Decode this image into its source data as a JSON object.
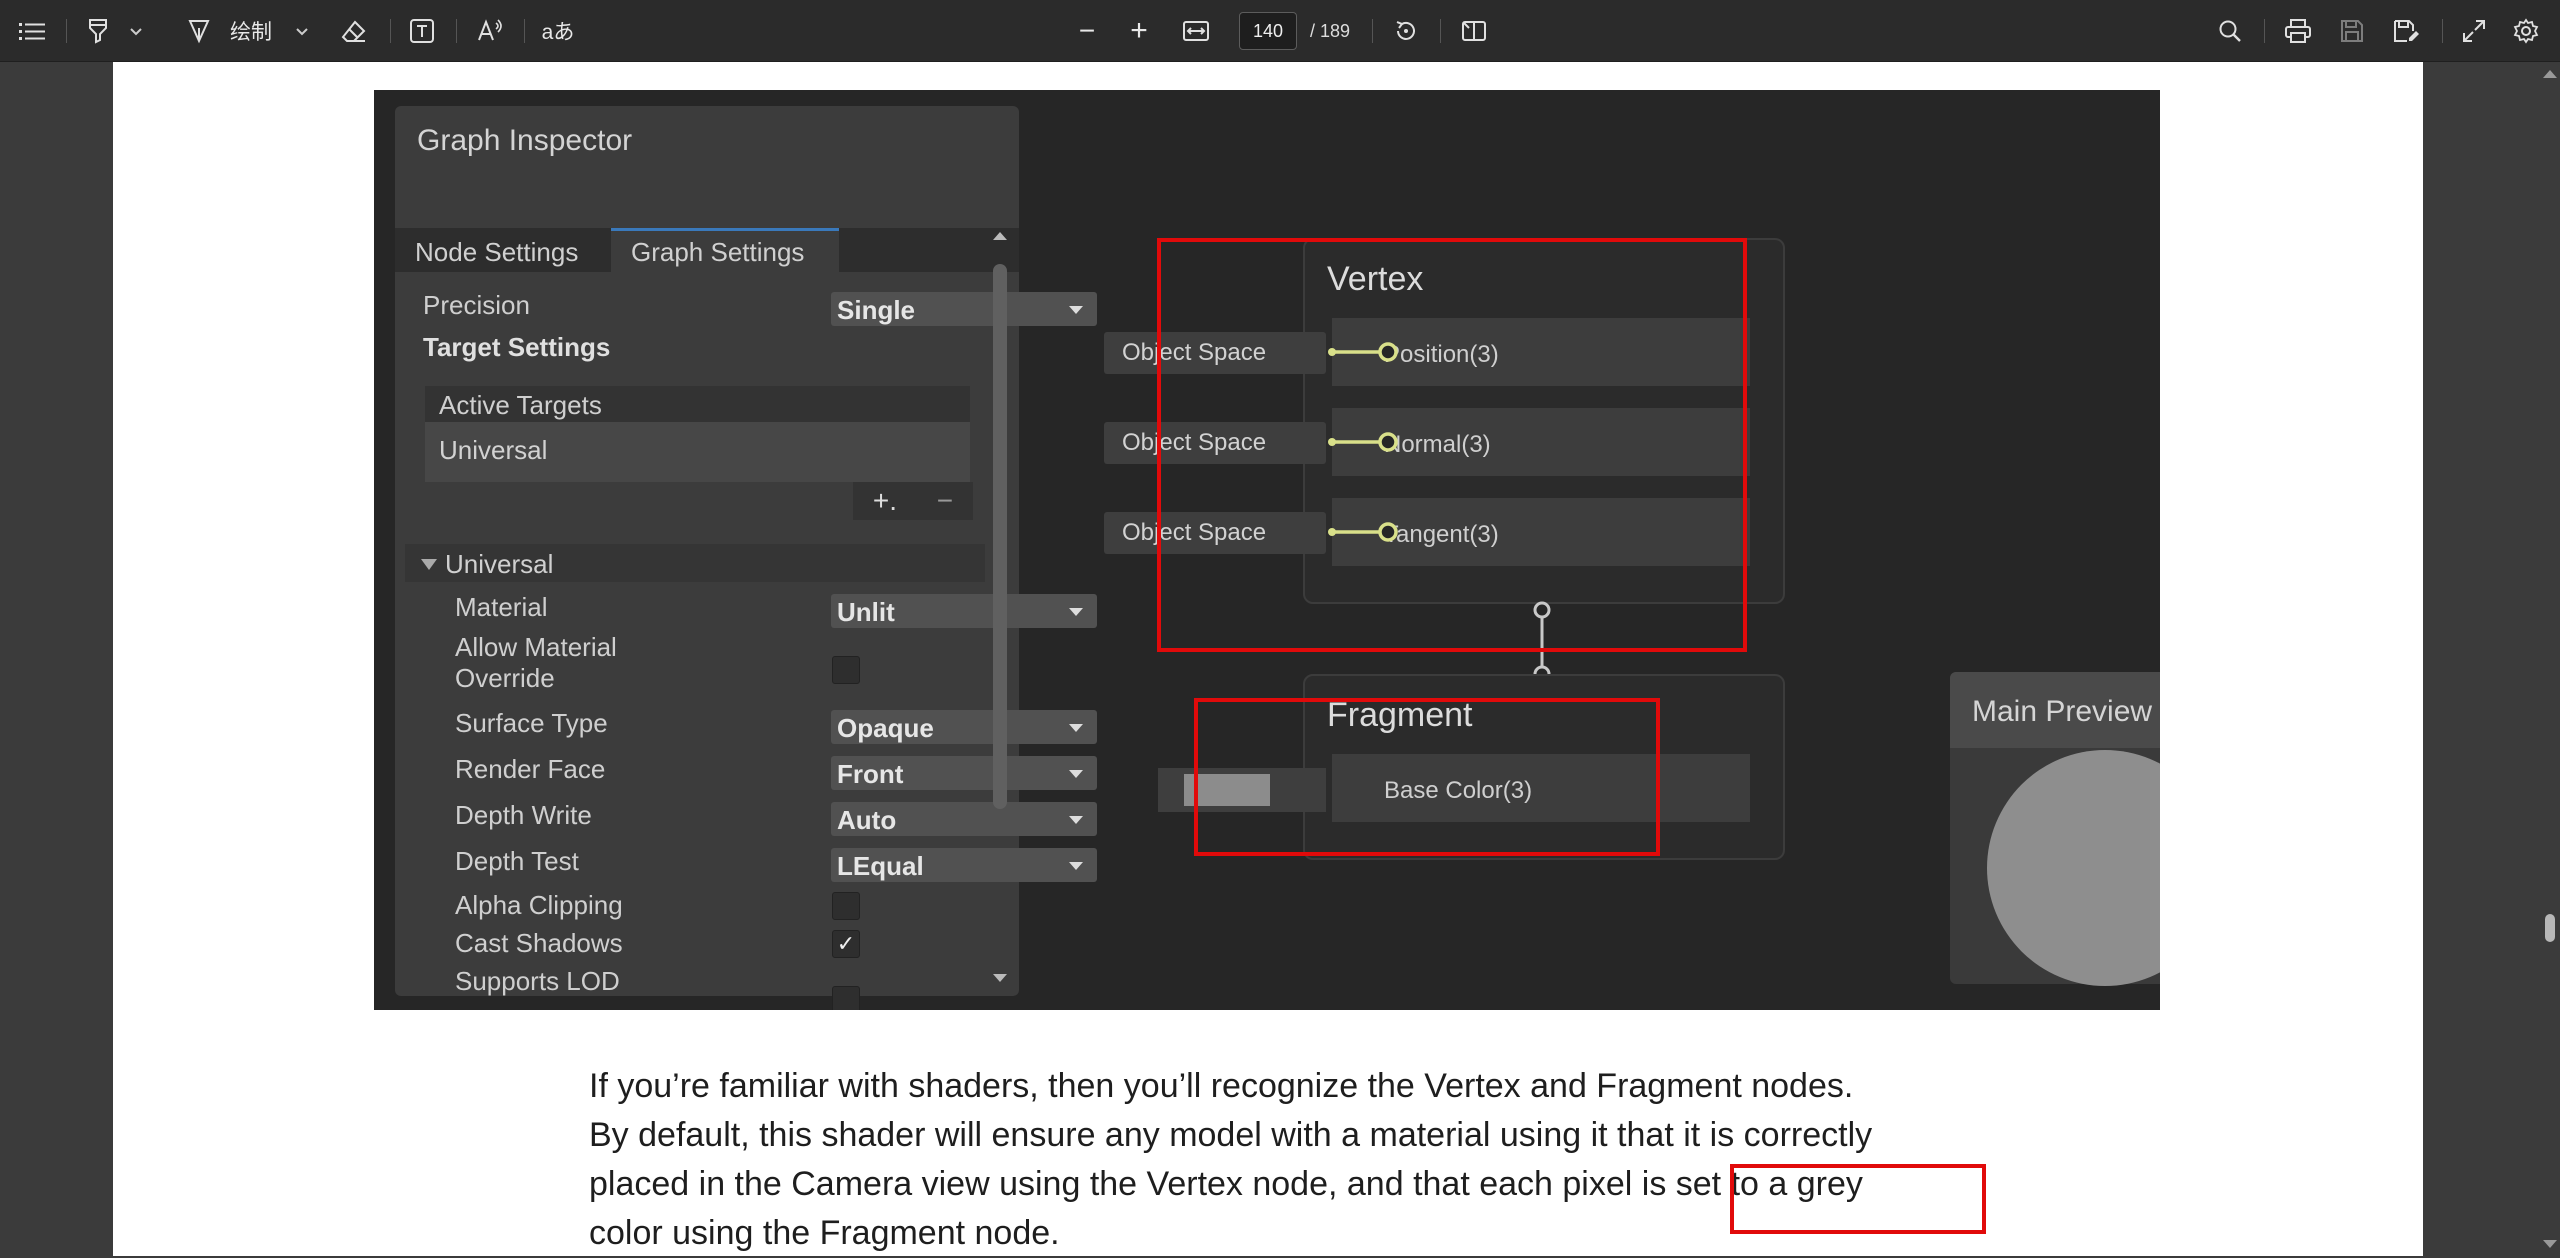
{
  "toolbar": {
    "outline_icon": "list-icon",
    "highlight_icon": "highlighter-icon",
    "draw_label": "绘制",
    "draw_icon": "pen-icon",
    "erase_icon": "eraser-icon",
    "textbox_icon": "text-box-icon",
    "read_aloud_icon": "read-aloud-icon",
    "translate_label": "aあ",
    "zoom_out_label": "−",
    "zoom_in_label": "+",
    "fit_icon": "fit-width-icon",
    "page_current": "140",
    "page_total": "/ 189",
    "rotate_icon": "rotate-icon",
    "page_view_icon": "page-view-icon",
    "right_icons": [
      "search-icon",
      "print-icon",
      "save-icon",
      "save-as-icon",
      "fullscreen-icon",
      "settings-icon"
    ]
  },
  "figure": {
    "inspector": {
      "title": "Graph Inspector",
      "tabs": [
        "Node Settings",
        "Graph Settings"
      ],
      "active_tab": "Graph Settings",
      "precision_label": "Precision",
      "precision_value": "Single",
      "target_settings_label": "Target Settings",
      "active_targets_label": "Active Targets",
      "target_item": "Universal",
      "add_label": "+.",
      "remove_label": "−",
      "section_label": "Universal",
      "rows": [
        {
          "label": "Material",
          "value": "Unlit"
        },
        {
          "label": "Allow Material",
          "label2": "Override",
          "checked": false
        },
        {
          "label": "Surface Type",
          "value": "Opaque"
        },
        {
          "label": "Render Face",
          "value": "Front"
        },
        {
          "label": "Depth Write",
          "value": "Auto"
        },
        {
          "label": "Depth Test",
          "value": "LEqual"
        },
        {
          "label": "Alpha Clipping",
          "checked": false
        },
        {
          "label": "Cast Shadows",
          "checked": true,
          "mark": "✓"
        },
        {
          "label": "Supports LOD",
          "checked": false
        }
      ]
    },
    "vertex": {
      "title": "Vertex",
      "ports": [
        "Position(3)",
        "Normal(3)",
        "Tangent(3)"
      ],
      "inputs": [
        "Object Space",
        "Object Space",
        "Object Space"
      ]
    },
    "fragment": {
      "title": "Fragment",
      "ports": [
        "Base Color(3)"
      ]
    },
    "preview": {
      "title": "Main Preview"
    },
    "colors": {
      "highlight_red": "#e10a0a",
      "port_yellow": "#d9e08a",
      "tab_accent": "#3a79bb"
    }
  },
  "paragraph": {
    "lines": [
      "If you’re familiar with shaders, then you’ll recognize the Vertex and Fragment nodes.",
      "By default, this shader will ensure any model with a material using it that it is correctly",
      "placed in the Camera view using the Vertex node, and that each pixel is set to a grey",
      "color using the Fragment node."
    ]
  }
}
